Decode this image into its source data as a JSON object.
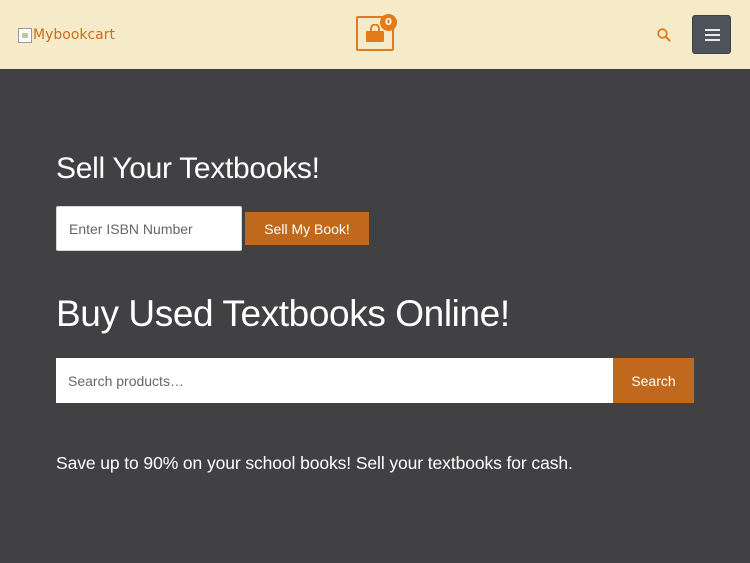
{
  "header": {
    "logo_alt": "Mybookcart",
    "cart_count": "0",
    "icons": {
      "cart": "shopping-bag-icon",
      "search": "search-icon",
      "menu": "hamburger-menu-icon"
    }
  },
  "sell": {
    "heading": "Sell Your Textbooks!",
    "isbn_placeholder": "Enter ISBN Number",
    "button_label": "Sell My Book!"
  },
  "buy": {
    "heading": "Buy Used Textbooks Online!",
    "search_placeholder": "Search products…",
    "search_button_label": "Search"
  },
  "tagline": "Save up to 90% on your school books! Sell your textbooks for cash.",
  "colors": {
    "header_bg": "#f6ebc9",
    "page_bg": "#414042",
    "accent": "#e47b1a",
    "button": "#c0691c",
    "menu_button": "#4d5359"
  }
}
